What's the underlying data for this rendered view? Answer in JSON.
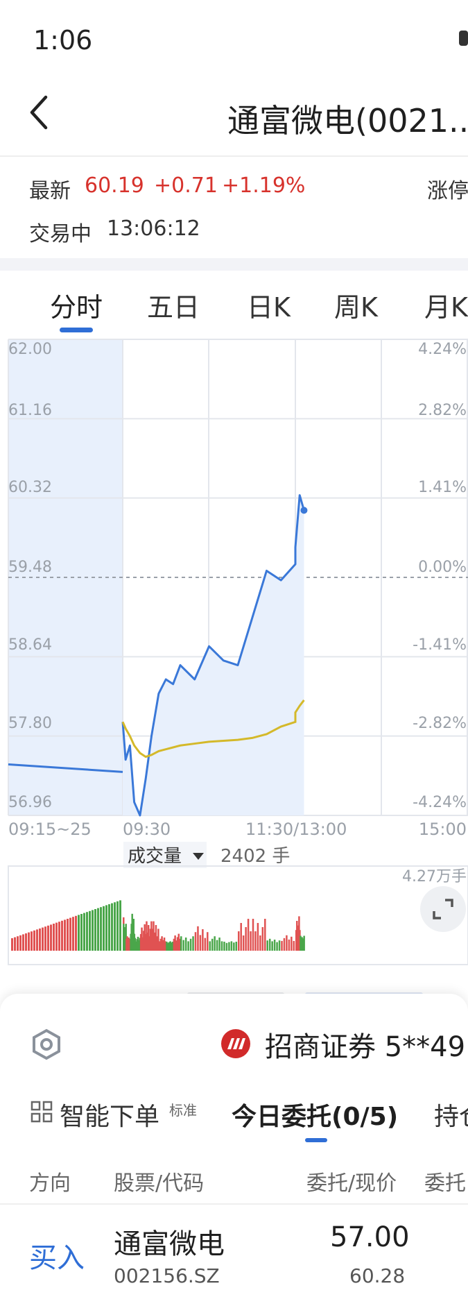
{
  "status_bar": {
    "time": "1:06"
  },
  "header": {
    "title": "通富微电(0021..",
    "back_icon": "chevron-left-icon"
  },
  "quote": {
    "latest_label": "最新",
    "price": "60.19",
    "change": "+0.71",
    "change_pct": "+1.19%",
    "limit_label": "涨停",
    "trade_status": "交易中",
    "trade_time": "13:06:12",
    "up_color": "#d7322c"
  },
  "period_tabs": [
    "分时",
    "五日",
    "日K",
    "周K",
    "月K"
  ],
  "active_period": "分时",
  "chart": {
    "price_labels": [
      "62.00",
      "61.16",
      "60.32",
      "59.48",
      "58.64",
      "57.80",
      "56.96"
    ],
    "pct_labels": [
      "4.24%",
      "2.82%",
      "1.41%",
      "0.00%",
      "-1.41%",
      "-2.82%",
      "-4.24%"
    ],
    "time_labels": [
      "09:15~25",
      "09:30",
      "11:30/13:00",
      "15:00"
    ],
    "volume_selector": "成交量",
    "volume_value": "2402 手",
    "volume_max": "4.27万手",
    "expand_icon": "expand-icon",
    "line_color": "#3a78d8",
    "avg_color": "#d4b92a"
  },
  "chart_data": {
    "type": "line",
    "title": "",
    "xlabel": "",
    "ylabel": "",
    "ylim": [
      56.96,
      62.0
    ],
    "prev_close": 59.48,
    "x": [
      "09:15",
      "09:25",
      "09:30",
      "09:32",
      "09:35",
      "09:38",
      "09:42",
      "09:46",
      "09:50",
      "09:55",
      "10:00",
      "10:05",
      "10:10",
      "10:20",
      "10:30",
      "10:40",
      "10:50",
      "11:00",
      "11:10",
      "11:20",
      "11:30",
      "13:00",
      "13:03",
      "13:06"
    ],
    "series": [
      {
        "values": [
          57.5,
          57.42,
          57.95,
          57.55,
          57.7,
          57.1,
          56.96,
          57.35,
          57.8,
          58.25,
          58.4,
          58.35,
          58.55,
          58.4,
          58.75,
          58.6,
          58.55,
          59.05,
          59.55,
          59.45,
          59.62,
          59.8,
          60.35,
          60.19
        ]
      },
      {
        "values": [
          null,
          null,
          57.95,
          57.88,
          57.8,
          57.7,
          57.62,
          57.58,
          57.6,
          57.64,
          57.66,
          57.68,
          57.7,
          57.72,
          57.74,
          57.75,
          57.76,
          57.78,
          57.82,
          57.9,
          57.95,
          58.05,
          58.12,
          58.18
        ]
      }
    ]
  },
  "sheet": {
    "settings_icon": "settings-icon",
    "broker_logo": "broker-logo-icon",
    "broker_name": "招商证券 5**49",
    "smart_icon": "grid-icon",
    "smart_order": "智能下单",
    "smart_badge": "标准",
    "orders_tab": "今日委托(0/5)",
    "hold_tab": "持仓",
    "columns": [
      "方向",
      "股票/代码",
      "委托/现价",
      "委托"
    ],
    "row": {
      "direction": "买入",
      "name": "通富微电",
      "code": "002156.SZ",
      "order_price": "57.00",
      "current_price": "60.28"
    }
  }
}
